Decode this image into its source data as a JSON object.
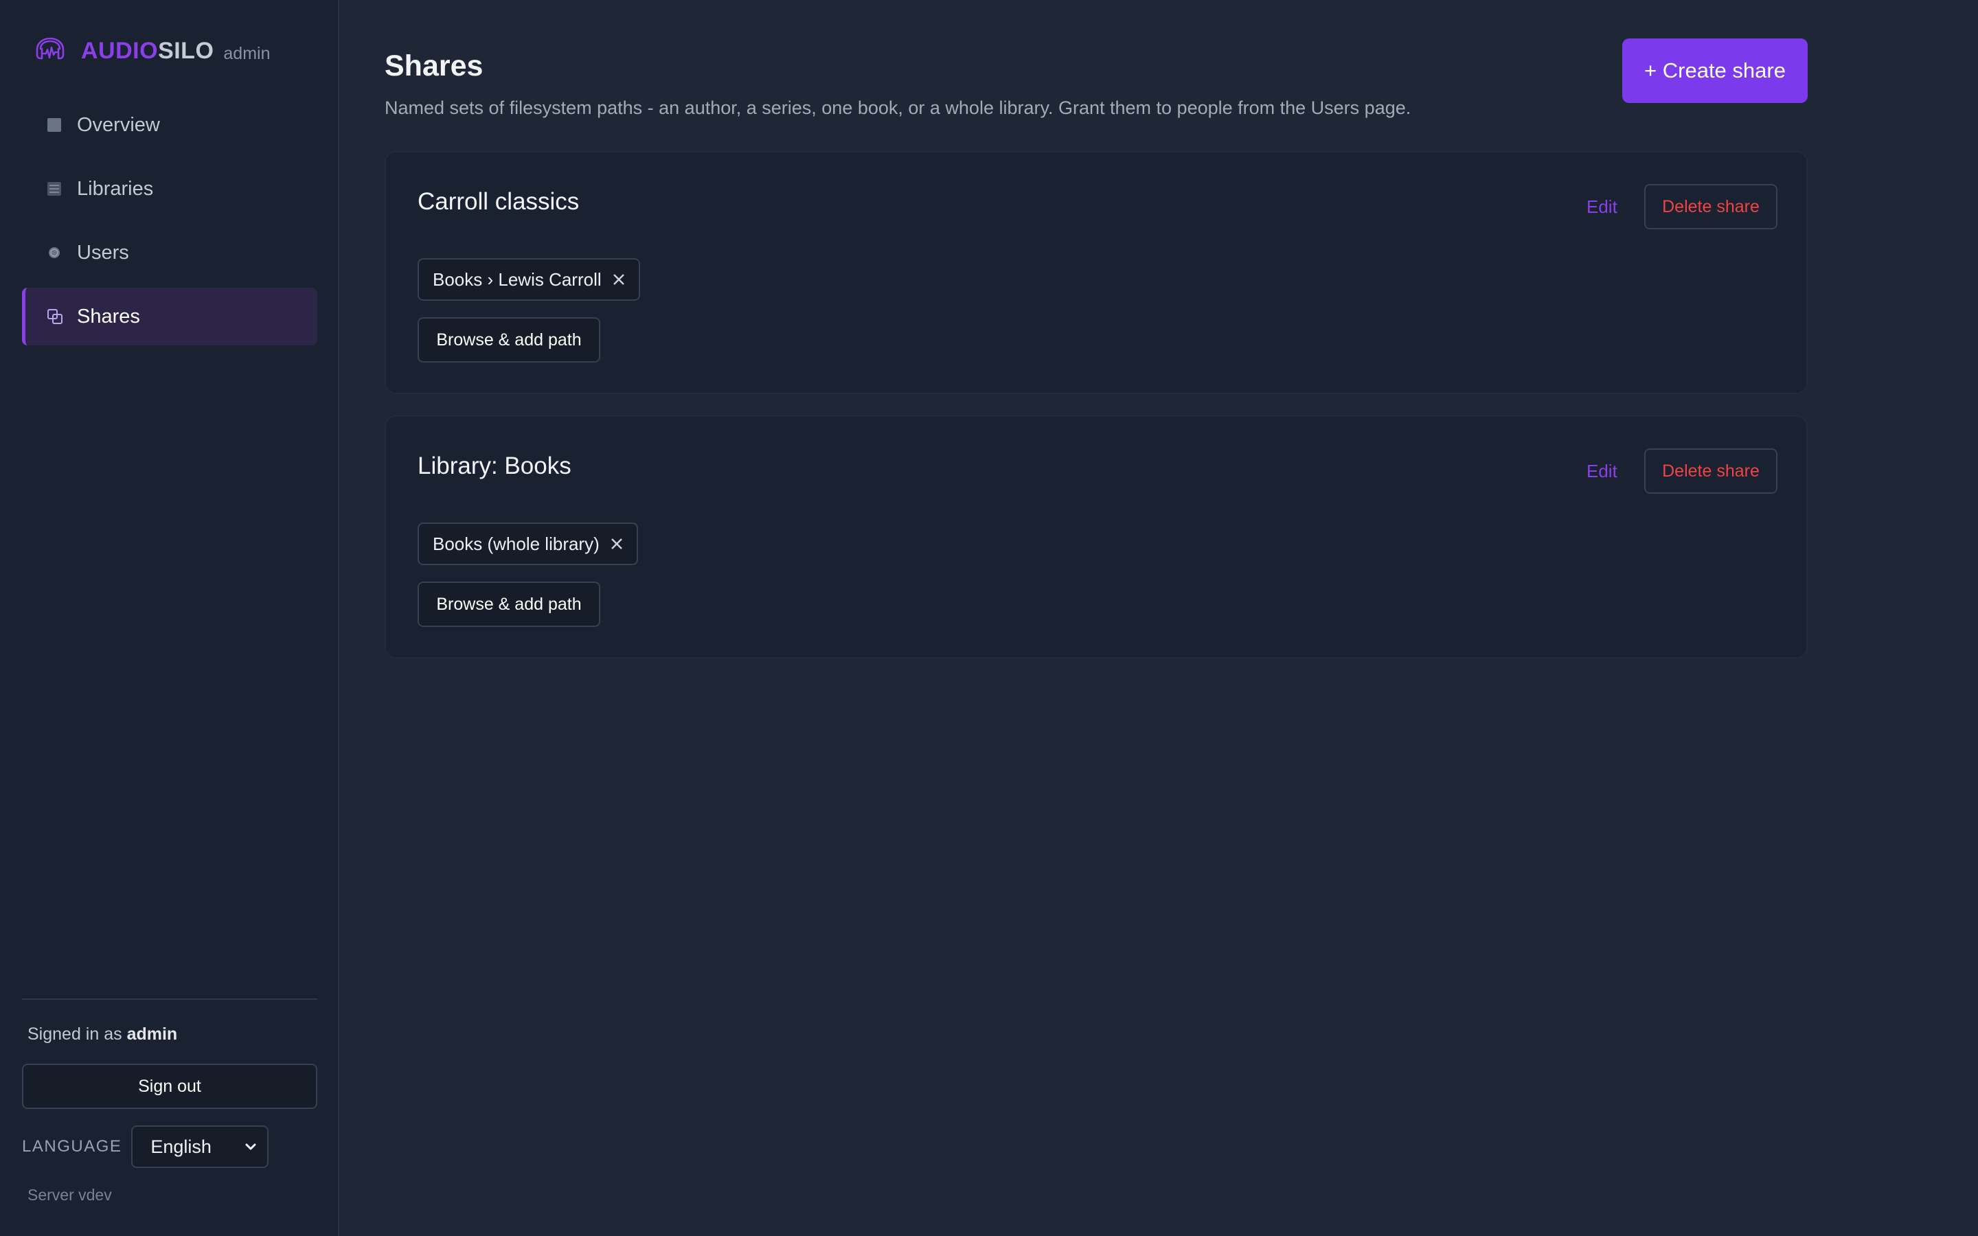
{
  "brand": {
    "name_part1": "AUDIO",
    "name_part2": "SILO",
    "role": "admin"
  },
  "nav": [
    {
      "label": "Overview",
      "icon": "square-icon"
    },
    {
      "label": "Libraries",
      "icon": "list-icon"
    },
    {
      "label": "Users",
      "icon": "user-dot-icon"
    },
    {
      "label": "Shares",
      "icon": "share-icon",
      "active": true
    }
  ],
  "sidebar_footer": {
    "signed_prefix": "Signed in as",
    "signed_user": "admin",
    "sign_out": "Sign out",
    "language_label": "LANGUAGE",
    "language_value": "English",
    "server": "Server vdev"
  },
  "page": {
    "title": "Shares",
    "subtitle": "Named sets of filesystem paths - an author, a series, one book, or a whole library. Grant them to people from the Users page.",
    "create_button": "+ Create share"
  },
  "shares": [
    {
      "name": "Carroll classics",
      "edit": "Edit",
      "delete": "Delete share",
      "paths": [
        "Books › Lewis Carroll"
      ],
      "browse": "Browse & add path"
    },
    {
      "name": "Library: Books",
      "edit": "Edit",
      "delete": "Delete share",
      "paths": [
        "Books (whole library)"
      ],
      "browse": "Browse & add path"
    }
  ],
  "colors": {
    "accent": "#7c3aed",
    "danger": "#ef4444",
    "background": "#1f2737",
    "sidebar": "#1a2131"
  }
}
